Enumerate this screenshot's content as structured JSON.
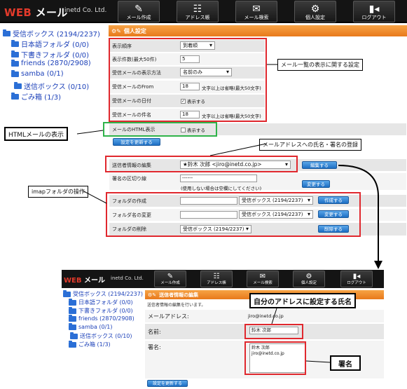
{
  "app": {
    "logo_web": "WEB",
    "logo_mail": " メール",
    "company": "inetd Co. Ltd."
  },
  "toolbar": [
    {
      "label": "メール作成",
      "icon": "compose-icon"
    },
    {
      "label": "アドレス帳",
      "icon": "address-book-icon"
    },
    {
      "label": "メール検索",
      "icon": "search-icon"
    },
    {
      "label": "個人設定",
      "icon": "settings-icon"
    },
    {
      "label": "ログアウト",
      "icon": "logout-icon"
    }
  ],
  "tree": {
    "inbox": "受信ボックス (2194/2237)",
    "f1": "日本語フォルダ (0/0)",
    "f2": "下書きフォルダ (0/0)",
    "f3": "friends (2870/2908)",
    "f4": "samba (0/1)",
    "f5": "送信ボックス (0/10)",
    "f6": "ごみ箱 (1/3)"
  },
  "settings": {
    "title": "個人設定",
    "order_label": "表示順序",
    "order_value": "到着順",
    "count_label": "表示件数(最大50件)",
    "count_value": "5",
    "from_mode_label": "受信メールの表示方法",
    "from_mode_value": "名前のみ",
    "from_label": "受信メールのFrom",
    "from_value": "18",
    "from_note": "文字以上は省略(最大50文字)",
    "date_label": "受信メールの日付",
    "date_check": "表示する",
    "subject_label": "受信メールの件名",
    "subject_value": "18",
    "subject_note": "文字以上は省略(最大50文字)",
    "html_label": "メールのHTML表示",
    "html_check": "表示する",
    "update_btn": "設定を更新する",
    "sender_label": "送信者情報の編集",
    "sender_value": "★鈴木 次郎 <jiro@inetd.co.jp>",
    "edit_btn": "編集する",
    "sig_label": "署名の区切り線",
    "sig_value": "------",
    "sig_note": "(使用しない場合は空欄にしてください)",
    "change_btn": "変更する",
    "fcreate_label": "フォルダの作成",
    "fcreate_sel": "受信ボックス (2194/2237)",
    "fcreate_btn": "作成する",
    "frename_label": "フォルダ名の変更",
    "frename_sel": "受信ボックス (2194/2237)",
    "frename_btn": "変更する",
    "fdelete_label": "フォルダの削除",
    "fdelete_sel": "受信ボックス (2194/2237)",
    "fdelete_btn": "削除する"
  },
  "callouts": {
    "list": "メール一覧の表示に関する設定",
    "html": "HTMLメールの表示",
    "addr": "メールアドレスへの氏名・署名の登録",
    "imap": "imapフォルダの操作",
    "name": "自分のアドレスに設定する氏名",
    "sig": "署名"
  },
  "second": {
    "title": "送信者情報の編集",
    "desc": "送信者情報の編集を行います。",
    "addr_label": "メールアドレス:",
    "addr_value": "jiro@inetd.co.jp",
    "name_label": "名前:",
    "name_value": "鈴木 次郎",
    "sig_label": "署名:",
    "sig_line1": "鈴木 次郎",
    "sig_line2": "jiro@inetd.co.jp",
    "update_btn": "設定を更新する"
  },
  "colors": {
    "accent": "#e8791b",
    "red": "#e0282e",
    "green": "#2fb34a",
    "link": "#1a3fb8"
  }
}
